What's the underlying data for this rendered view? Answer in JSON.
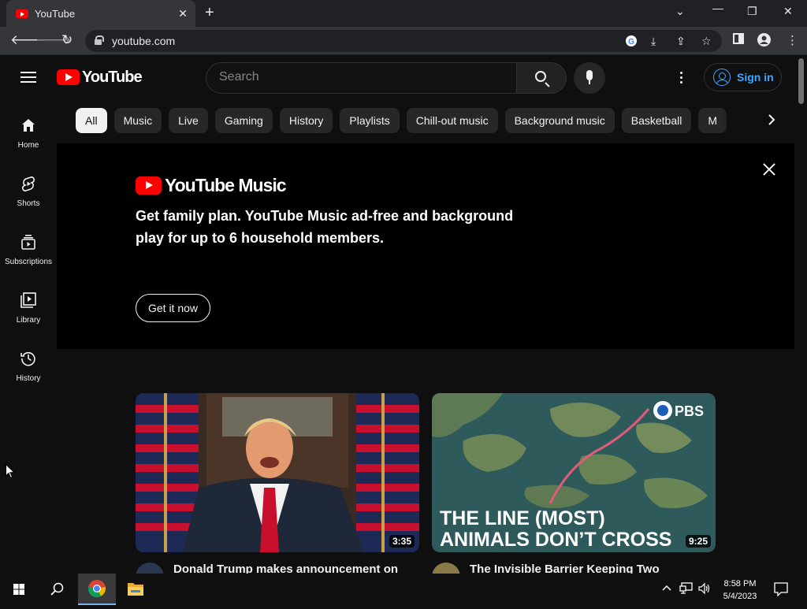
{
  "browser": {
    "tab_title": "YouTube",
    "url": "youtube.com"
  },
  "header": {
    "logo_text": "YouTube",
    "search_placeholder": "Search",
    "signin_label": "Sign in"
  },
  "chips": [
    "All",
    "Music",
    "Live",
    "Gaming",
    "History",
    "Playlists",
    "Chill-out music",
    "Background music",
    "Basketball",
    "M"
  ],
  "guide": [
    {
      "label": "Home",
      "icon": "home-icon"
    },
    {
      "label": "Shorts",
      "icon": "shorts-icon"
    },
    {
      "label": "Subscriptions",
      "icon": "subscriptions-icon"
    },
    {
      "label": "Library",
      "icon": "library-icon"
    },
    {
      "label": "History",
      "icon": "history-icon"
    }
  ],
  "banner": {
    "logo_text": "YouTube Music",
    "text": "Get family plan. YouTube Music ad-free and background play for up to 6 household members.",
    "cta": "Get it now"
  },
  "videos": [
    {
      "title": "Donald Trump makes announcement on",
      "duration": "3:35"
    },
    {
      "title": "The Invisible Barrier Keeping Two",
      "duration": "9:25",
      "thumb_text_1": "THE LINE (MOST)",
      "thumb_text_2": "ANIMALS DON’T CROSS",
      "channel_badge": "PBS"
    }
  ],
  "taskbar": {
    "time": "8:58 PM",
    "date": "5/4/2023"
  },
  "colors": {
    "background": "#0f0f0f",
    "brand_red": "#ff0000",
    "link_blue": "#3ea6ff",
    "chip": "#272727"
  }
}
